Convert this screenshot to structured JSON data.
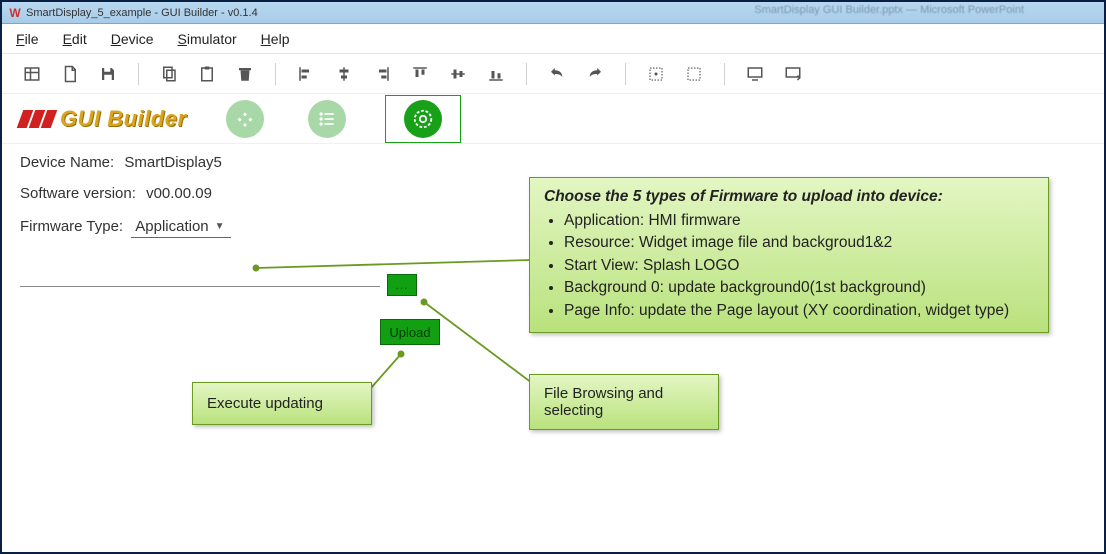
{
  "window": {
    "title": "SmartDisplay_5_example - GUI Builder - v0.1.4",
    "faded_bg_title": "SmartDisplay GUI Builder.pptx — Microsoft PowerPoint"
  },
  "menu": {
    "file": "File",
    "edit": "Edit",
    "device": "Device",
    "simulator": "Simulator",
    "help": "Help"
  },
  "brand": {
    "text": "GUI Builder"
  },
  "info": {
    "device_label": "Device Name:",
    "device_value": "SmartDisplay5",
    "version_label": "Software version:",
    "version_value": "v00.00.09",
    "fw_label": "Firmware Type:",
    "fw_value": "Application"
  },
  "buttons": {
    "browse": "...",
    "upload": "Upload"
  },
  "callout_main": {
    "heading": "Choose the 5 types of Firmware to upload into device:",
    "items": [
      "Application: HMI firmware",
      "Resource: Widget image file and backgroud1&2",
      "Start View: Splash LOGO",
      "Background 0: update background0(1st background)",
      "Page Info: update the Page layout (XY coordination, widget type)"
    ]
  },
  "callout_browse": "File Browsing and selecting",
  "callout_upload": "Execute updating"
}
